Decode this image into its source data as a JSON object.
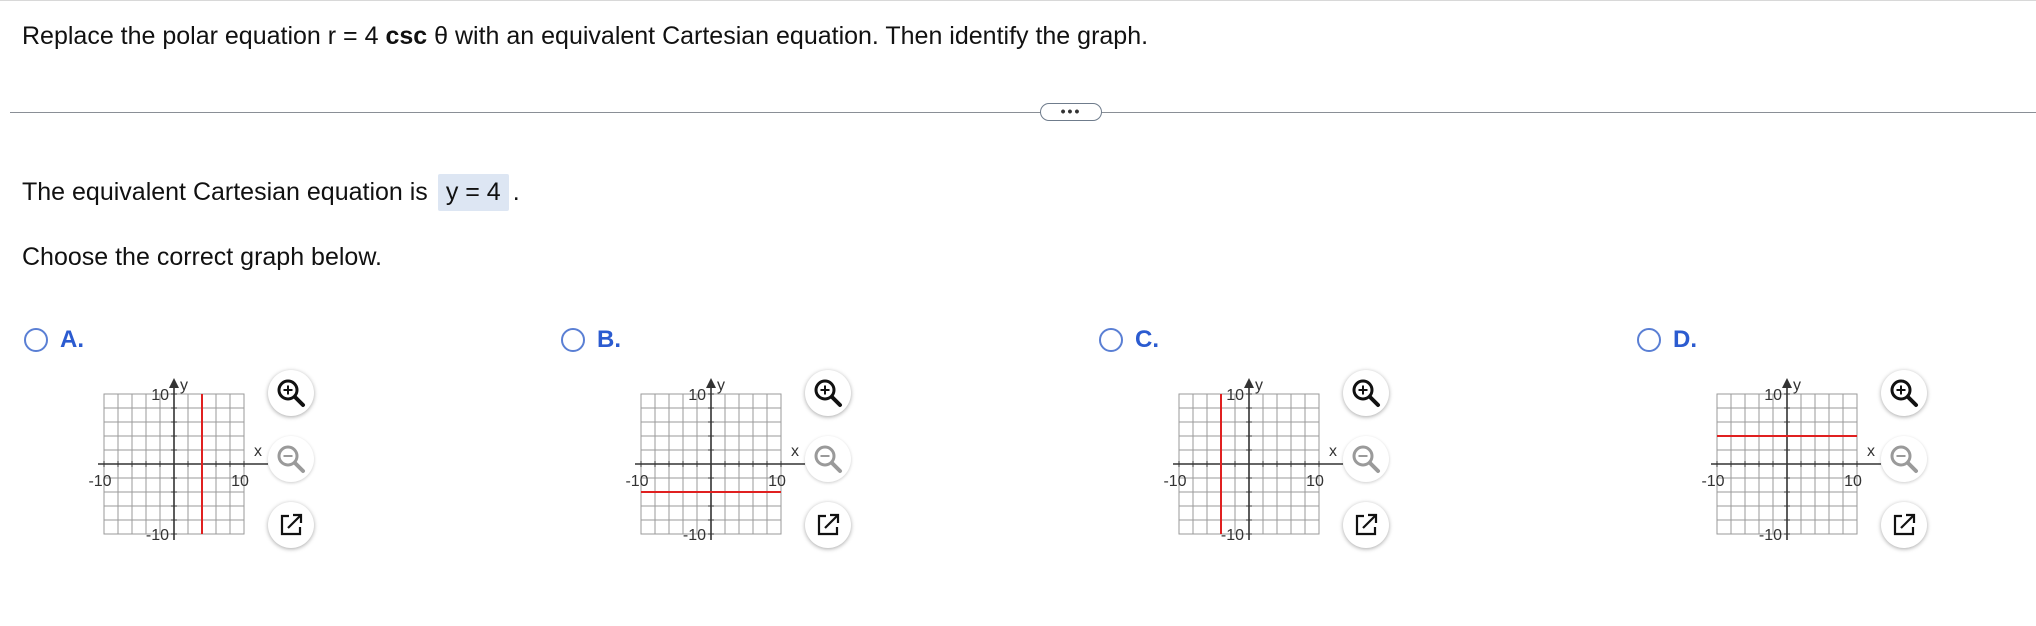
{
  "question": {
    "pre": "Replace the polar equation r",
    "eq_sign": " = ",
    "four": "4 ",
    "csc": "csc",
    "theta": " θ",
    "post": " with an equivalent Cartesian equation. Then identify the graph."
  },
  "more_label": "•••",
  "answer": {
    "lead": "The equivalent Cartesian equation is",
    "value": "y = 4",
    "trail": "."
  },
  "prompt": "Choose the correct graph below.",
  "options": [
    {
      "letter": "A.",
      "line": {
        "orientation": "vertical",
        "value": 4
      }
    },
    {
      "letter": "B.",
      "line": {
        "orientation": "horizontal",
        "value": -4
      }
    },
    {
      "letter": "C.",
      "line": {
        "orientation": "vertical",
        "value": -4
      }
    },
    {
      "letter": "D.",
      "line": {
        "orientation": "horizontal",
        "value": 4
      }
    }
  ],
  "graph": {
    "x_label": "x",
    "y_label": "y",
    "x_min_label": "-10",
    "x_max_label": "10",
    "y_min_label": "-10",
    "y_max_label": "10",
    "range": [
      -10,
      10
    ],
    "grid_step": 2,
    "grid_color": "#9a9a9a",
    "axis_color": "#333333",
    "line_color": "#e02020"
  },
  "tools": {
    "zoom_in": "zoom-in-icon",
    "zoom_out": "zoom-out-icon",
    "expand": "open-external-icon"
  },
  "accent": "#2b5bd0"
}
